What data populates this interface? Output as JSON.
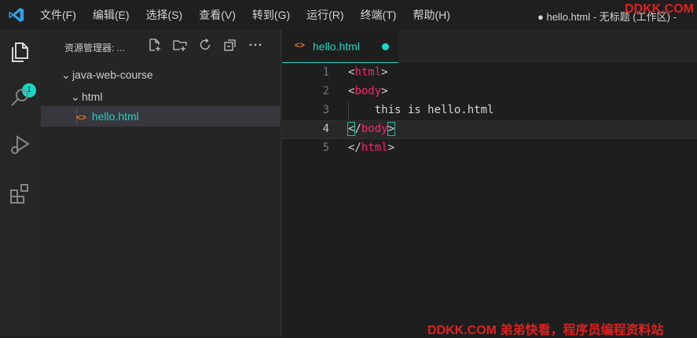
{
  "menu": [
    "文件(F)",
    "编辑(E)",
    "选择(S)",
    "查看(V)",
    "转到(G)",
    "运行(R)",
    "终端(T)",
    "帮助(H)"
  ],
  "window_title": "● hello.html - 无标题 (工作区) -",
  "watermark_top": "DDKK.COM",
  "watermark_bottom": "DDKK.COM 弟弟快看，程序员编程资料站",
  "activity": {
    "explorer_badge": "1"
  },
  "sidebar": {
    "title": "资源管理器: ...",
    "tree": {
      "root": "java-web-course",
      "folder": "html",
      "file": "hello.html"
    }
  },
  "tab": {
    "label": "hello.html"
  },
  "editor": {
    "line_numbers": [
      "1",
      "2",
      "3",
      "4",
      "5"
    ],
    "active_line": 4,
    "lines": {
      "l1_tag": "html",
      "l2_tag": "body",
      "l3_text": "    this is hello.html",
      "l4_tag": "body",
      "l5_tag": "html"
    }
  },
  "colors": {
    "accent": "#19d8c6",
    "tag": "#f7266d",
    "file_icon": "#e37933",
    "watermark": "#e02020"
  }
}
